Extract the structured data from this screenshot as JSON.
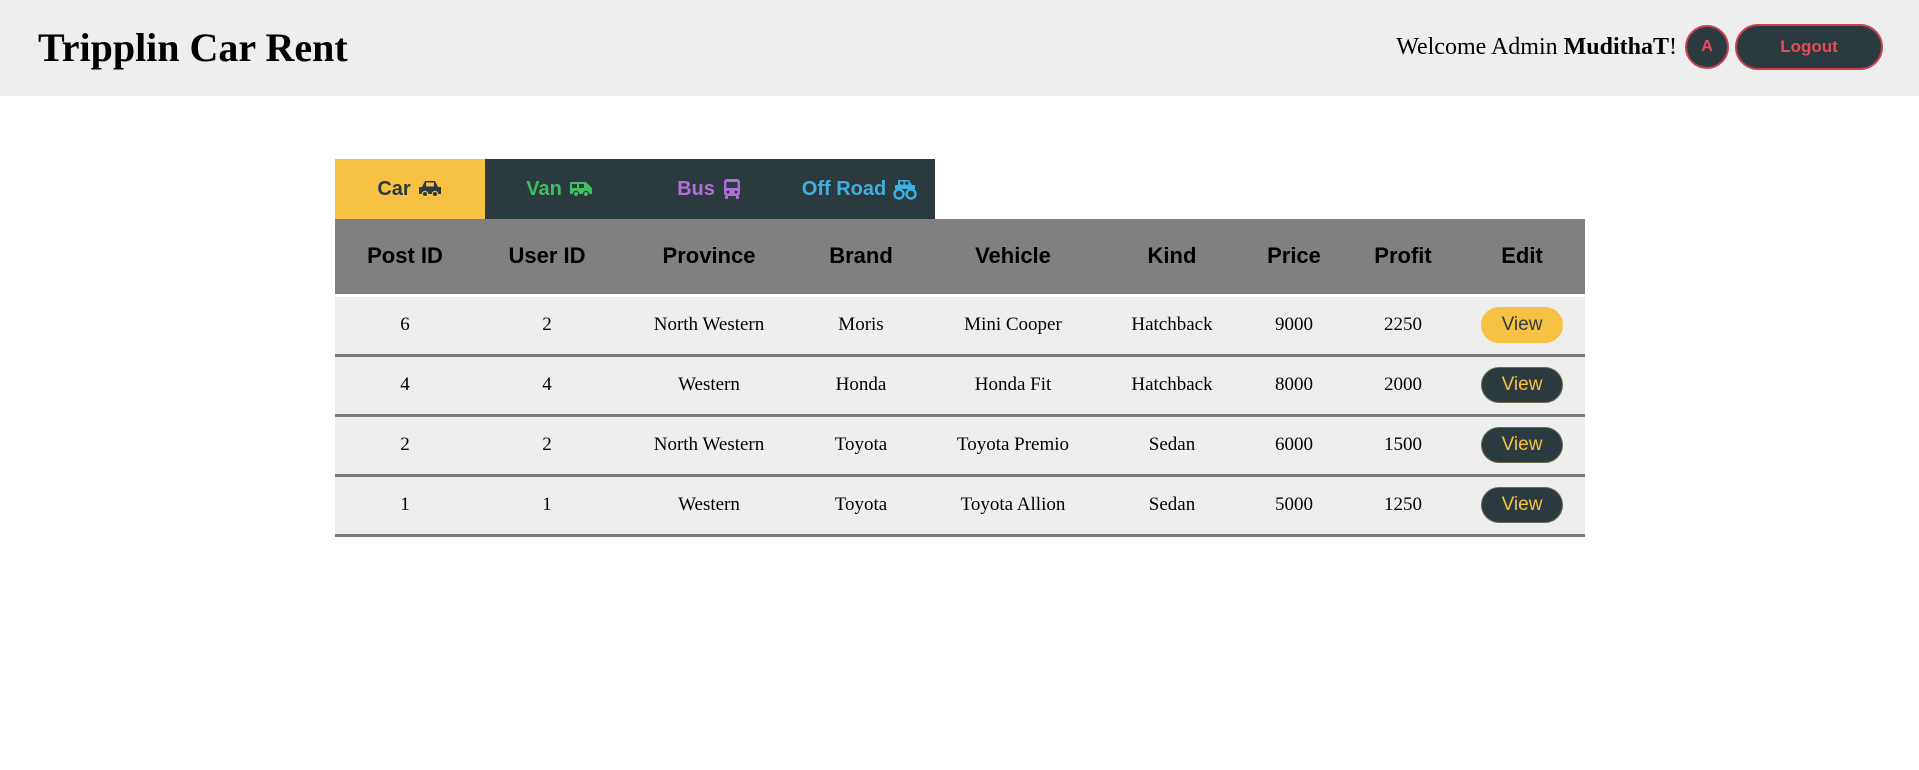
{
  "header": {
    "title": "Tripplin Car Rent",
    "welcome_prefix": "Welcome Admin",
    "username": "MudithaT",
    "welcome_suffix": "!",
    "avatar_letter": "A",
    "logout_label": "Logout"
  },
  "tabs": [
    {
      "label": "Car",
      "icon": "car-icon",
      "color": "#2b3a3f",
      "bg": "#f7c144",
      "active": true
    },
    {
      "label": "Van",
      "icon": "van-icon",
      "color": "#3fbf5f",
      "bg": "#2b3a3f",
      "active": false
    },
    {
      "label": "Bus",
      "icon": "bus-icon",
      "color": "#b06fd8",
      "bg": "#2b3a3f",
      "active": false
    },
    {
      "label": "Off Road",
      "icon": "monster-truck-icon",
      "color": "#3fb0e0",
      "bg": "#2b3a3f",
      "active": false
    }
  ],
  "table": {
    "columns": [
      "Post ID",
      "User ID",
      "Province",
      "Brand",
      "Vehicle",
      "Kind",
      "Price",
      "Profit",
      "Edit"
    ],
    "rows": [
      {
        "post_id": "6",
        "user_id": "2",
        "province": "North Western",
        "brand": "Moris",
        "vehicle": "Mini Cooper",
        "kind": "Hatchback",
        "price": "9000",
        "profit": "2250",
        "action": "View",
        "highlighted": true
      },
      {
        "post_id": "4",
        "user_id": "4",
        "province": "Western",
        "brand": "Honda",
        "vehicle": "Honda Fit",
        "kind": "Hatchback",
        "price": "8000",
        "profit": "2000",
        "action": "View",
        "highlighted": false
      },
      {
        "post_id": "2",
        "user_id": "2",
        "province": "North Western",
        "brand": "Toyota",
        "vehicle": "Toyota Premio",
        "kind": "Sedan",
        "price": "6000",
        "profit": "1500",
        "action": "View",
        "highlighted": false
      },
      {
        "post_id": "1",
        "user_id": "1",
        "province": "Western",
        "brand": "Toyota",
        "vehicle": "Toyota Allion",
        "kind": "Sedan",
        "price": "5000",
        "profit": "1250",
        "action": "View",
        "highlighted": false
      }
    ]
  },
  "colors": {
    "accent_yellow": "#f7c144",
    "dark_slate": "#2b3a3f",
    "logout_red": "#e84c5c",
    "header_bg": "#eeeeee",
    "table_header_bg": "#808080"
  }
}
